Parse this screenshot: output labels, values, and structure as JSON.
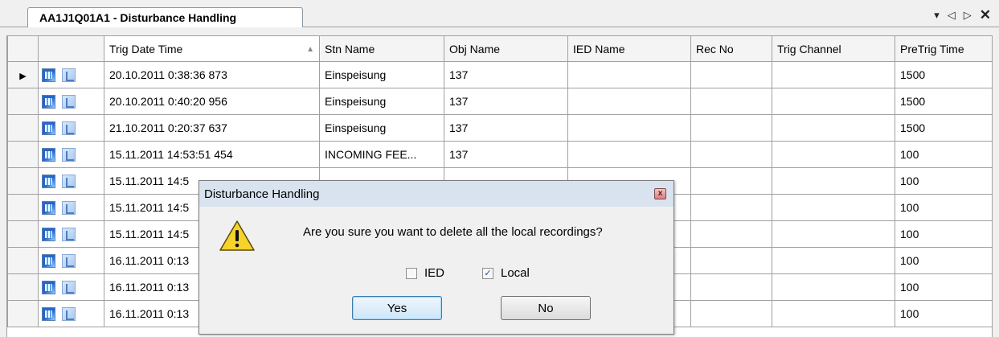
{
  "tab": {
    "title": "AA1J1Q01A1 - Disturbance Handling"
  },
  "window_controls": {
    "dropdown": "▾",
    "prev": "◁",
    "next": "▷",
    "close": "✕"
  },
  "grid": {
    "columns": [
      "Trig Date Time",
      "Stn Name",
      "Obj Name",
      "IED Name",
      "Rec No",
      "Trig Channel",
      "PreTrig Time"
    ],
    "sorted_column": "Trig Date Time",
    "current_row_marker": "▶",
    "rows": [
      [
        "20.10.2011 0:38:36 873",
        "Einspeisung",
        "137",
        "",
        "",
        "",
        "1500"
      ],
      [
        "20.10.2011 0:40:20 956",
        "Einspeisung",
        "137",
        "",
        "",
        "",
        "1500"
      ],
      [
        "21.10.2011 0:20:37 637",
        "Einspeisung",
        "137",
        "",
        "",
        "",
        "1500"
      ],
      [
        "15.11.2011 14:53:51 454",
        "INCOMING FEE...",
        "137",
        "",
        "",
        "",
        "100"
      ],
      [
        "15.11.2011 14:5",
        "",
        "",
        "",
        "",
        "",
        "100"
      ],
      [
        "15.11.2011 14:5",
        "",
        "",
        "",
        "",
        "",
        "100"
      ],
      [
        "15.11.2011 14:5",
        "",
        "",
        "",
        "",
        "",
        "100"
      ],
      [
        "16.11.2011 0:13",
        "",
        "",
        "",
        "",
        "",
        "100"
      ],
      [
        "16.11.2011 0:13",
        "",
        "",
        "",
        "",
        "",
        "100"
      ],
      [
        "16.11.2011 0:13",
        "",
        "",
        "",
        "",
        "",
        "100"
      ]
    ]
  },
  "dialog": {
    "title": "Disturbance Handling",
    "close_glyph": "x",
    "message": "Are you sure you want to delete all the local recordings?",
    "checkbox_ied": {
      "label": "IED",
      "checked": false
    },
    "checkbox_local": {
      "label": "Local",
      "checked": true,
      "mark": "✓"
    },
    "yes_label": "Yes",
    "no_label": "No"
  },
  "colors": {
    "accent": "#3c7fb1",
    "grid_border": "#a0a0a0",
    "titlebar": "#d9e3ef"
  }
}
